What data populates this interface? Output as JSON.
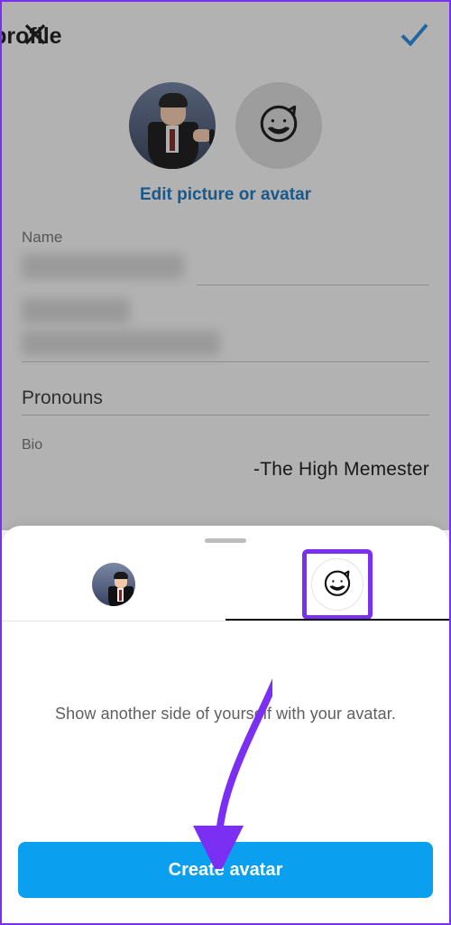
{
  "colors": {
    "accent": "#7a2ff2",
    "link": "#166fb8",
    "cta": "#0aa0ef"
  },
  "header": {
    "title": "Edit profile",
    "close_icon": "close-icon",
    "confirm_icon": "check-icon"
  },
  "avatars": {
    "edit_link": "Edit picture or avatar"
  },
  "fields": {
    "name_label": "Name",
    "pronouns_label": "Pronouns",
    "bio_label": "Bio",
    "bio_value": "-The High Memester"
  },
  "sheet": {
    "tabs": [
      {
        "id": "photo",
        "label": "Profile photo"
      },
      {
        "id": "avatar",
        "label": "Avatar"
      }
    ],
    "active_tab": "avatar",
    "body_text": "Show another side of yourself with your avatar.",
    "cta_label": "Create avatar"
  }
}
